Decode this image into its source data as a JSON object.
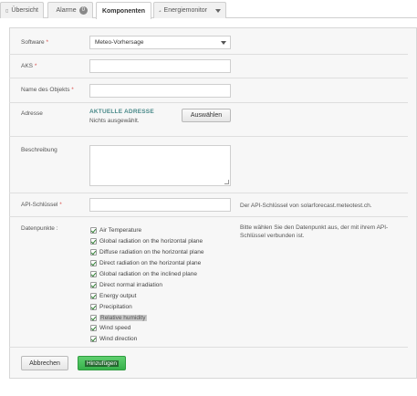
{
  "tabs": [
    {
      "label": "Übersicht",
      "icon": "home-icon"
    },
    {
      "label": "Alarme",
      "icon": "bell-icon",
      "badge": "0"
    },
    {
      "label": "Komponenten",
      "active": true
    },
    {
      "label": "Energiemonitor",
      "icon": "bar-chart-icon",
      "dropdown": true
    }
  ],
  "form": {
    "software": {
      "label": "Software",
      "value": "Meteo-Vorhersage"
    },
    "aks": {
      "label": "AKS"
    },
    "object_name": {
      "label": "Name des Objekts"
    },
    "address": {
      "label": "Adresse",
      "title": "AKTUELLE ADRESSE",
      "status": "Nichts ausgewählt.",
      "button": "Auswählen"
    },
    "description": {
      "label": "Beschreibung"
    },
    "api_key": {
      "label": "API-Schlüssel",
      "hint": "Der API-Schlüssel von solarforecast.meteotest.ch."
    },
    "datapoints": {
      "label": "Datenpunkte :",
      "hint": "Bitte wählen Sie den Datenpunkt aus, der mit ihrem API-Schlüssel verbunden ist.",
      "items": [
        "Air Temperature",
        "Global radiation on the horizontal plane",
        "Diffuse radiation on the horizontal plane",
        "Direct radiation on the horizontal plane",
        "Global radiation on the inclined plane",
        "Direct normal irradiation",
        "Energy output",
        "Precipitation",
        "Relative humidity",
        "Wind speed",
        "Wind direction"
      ]
    },
    "required_marker": "*"
  },
  "buttons": {
    "cancel": "Abbrechen",
    "add": "Hinzufügen"
  }
}
